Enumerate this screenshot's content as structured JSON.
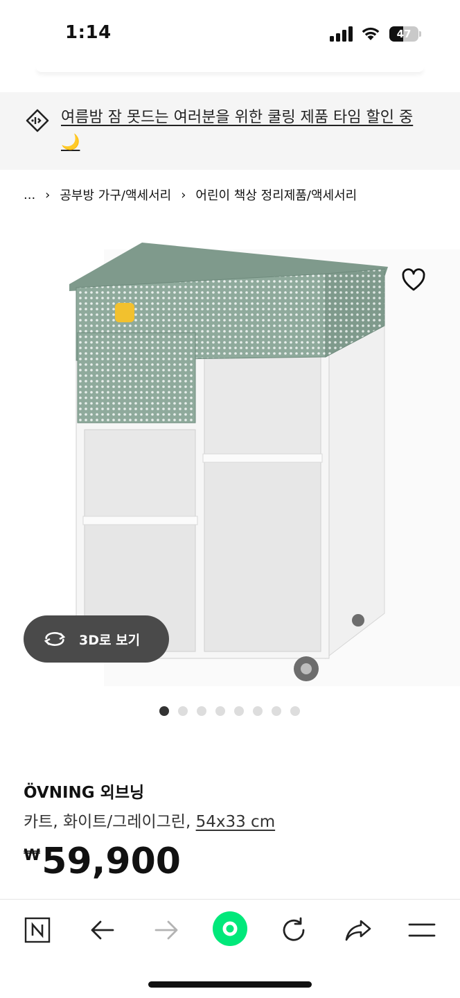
{
  "status_bar": {
    "time": "1:14",
    "battery": "47"
  },
  "promo": {
    "text": "여름밤 잠 못드는 여러분을 위한 쿨링 제품 타임 할인 중🌙",
    "icon": "price-tag-icon"
  },
  "breadcrumb": {
    "ellipsis": "...",
    "items": [
      "공부방 가구/액세서리",
      "어린이 책상 정리제품/액세서리"
    ]
  },
  "product_image": {
    "view_3d_label": "3D로 보기",
    "carousel_count": 8,
    "active_index": 0
  },
  "product": {
    "name": "ÖVNING 외브닝",
    "description": "카트, 화이트/그레이그린, ",
    "size": "54x33 cm",
    "currency": "₩",
    "price": "59,900"
  },
  "colors": {
    "accent_green": "#00e87a",
    "banner_bg": "#f5f5f5",
    "cart_green": "#8faa9c"
  },
  "bottom_nav": [
    "naver-icon",
    "back-icon",
    "forward-icon",
    "home-green-icon",
    "refresh-icon",
    "share-icon",
    "menu-icon"
  ]
}
